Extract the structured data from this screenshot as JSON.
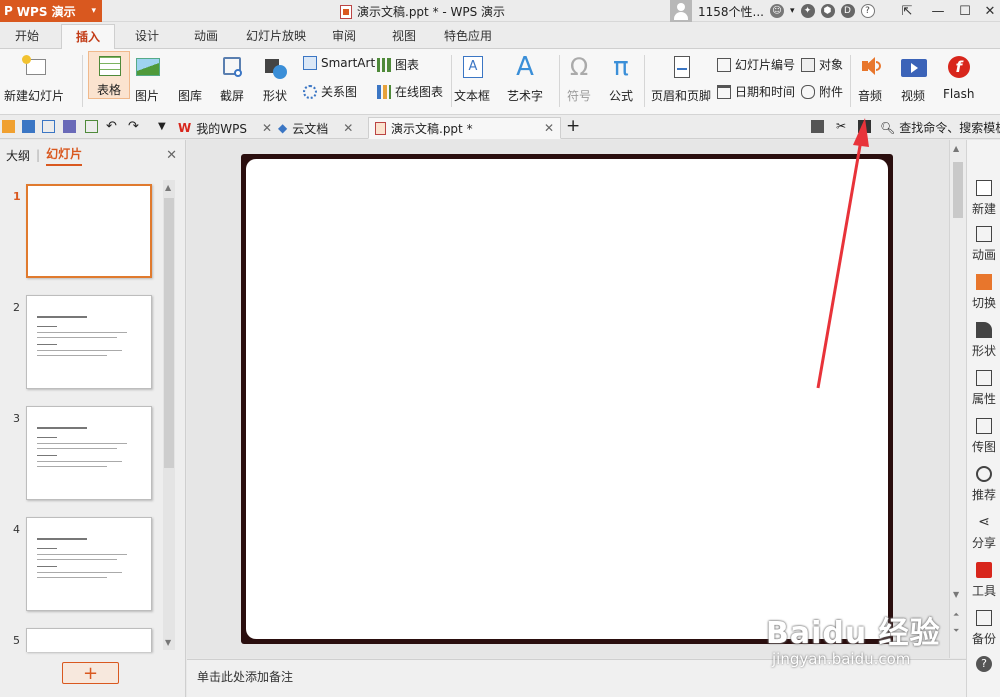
{
  "titlebar": {
    "app_label": "WPS 演示",
    "doc_title": "演示文稿.ppt * - WPS 演示",
    "user_label": "1158个性..."
  },
  "menu": {
    "tabs": [
      "开始",
      "插入",
      "设计",
      "动画",
      "幻灯片放映",
      "审阅",
      "视图",
      "特色应用"
    ],
    "active": "插入"
  },
  "ribbon": {
    "new_slide": "新建幻灯片",
    "table": "表格",
    "picture": "图片",
    "gallery": "图库",
    "screenshot": "截屏",
    "shape": "形状",
    "smartart": "SmartArt",
    "chart": "图表",
    "relation": "关系图",
    "online_chart": "在线图表",
    "textbox": "文本框",
    "wordart": "艺术字",
    "symbol": "符号",
    "formula": "公式",
    "header_footer": "页眉和页脚",
    "slide_number": "幻灯片编号",
    "object": "对象",
    "date_time": "日期和时间",
    "attachment": "附件",
    "audio": "音频",
    "video": "视频",
    "flash": "Flash"
  },
  "doc_tabs": {
    "my_wps": "我的WPS",
    "cloud": "云文档",
    "active_doc": "演示文稿.ppt *",
    "search": "查找命令、搜索模板"
  },
  "left_panel": {
    "tab_outline": "大纲",
    "tab_slides": "幻灯片",
    "slide_numbers": [
      "1",
      "2",
      "3",
      "4",
      "5"
    ],
    "add_button": "+"
  },
  "notes_placeholder": "单击此处添加备注",
  "right_panel": [
    "新建",
    "动画",
    "切换",
    "形状",
    "属性",
    "传图",
    "推荐",
    "分享",
    "工具",
    "备份"
  ],
  "watermark": {
    "brand": "Baidu 经验",
    "url": "jingyan.baidu.com"
  },
  "colors": {
    "accent": "#d9581f",
    "annotation_arrow": "#e8333a"
  }
}
